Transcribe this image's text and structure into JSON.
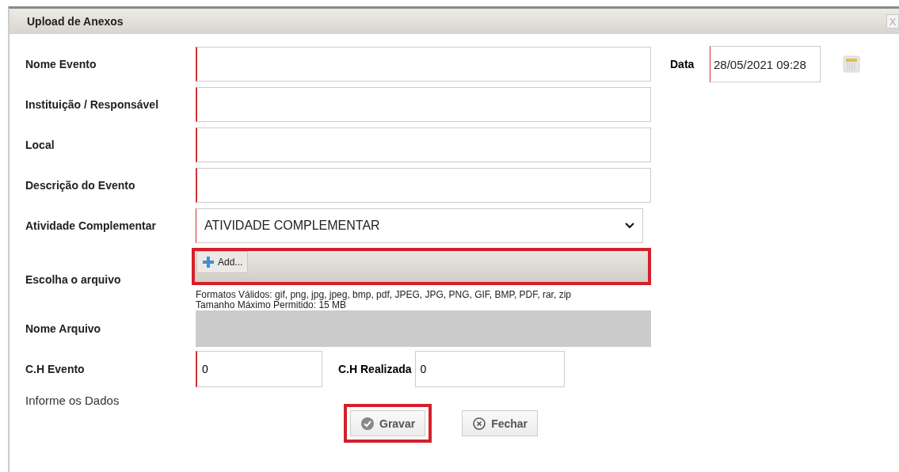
{
  "window": {
    "title": "Upload de Anexos",
    "close": "X"
  },
  "fields": [
    {
      "label": "Nome Evento",
      "required": true
    },
    {
      "label": "Instituição / Responsável",
      "required": true
    },
    {
      "label": "Local",
      "required": true
    },
    {
      "label": "Descrição do Evento",
      "required": true
    }
  ],
  "date": {
    "label": "Data",
    "value": "28/05/2021 09:28"
  },
  "activity": {
    "label": "Atividade Complementar",
    "value": "ATIVIDADE COMPLEMENTAR"
  },
  "file": {
    "label": "Escolha o arquivo",
    "add_button": "Add...",
    "highlighted": true,
    "formats": "Formatos Válidos: gif, png, jpg, jpeg, bmp, pdf, JPEG, JPG, PNG, GIF, BMP, PDF, rar, zip",
    "max_size": "Tamanho Máximo Permitido: 15 MB"
  },
  "file_name": {
    "label": "Nome Arquivo"
  },
  "hours": [
    {
      "label": "C.H Evento",
      "value": "0"
    },
    {
      "label": "C.H Realizada",
      "value": "0"
    }
  ],
  "message": "Informe os Dados",
  "buttons": [
    {
      "label": "Gravar",
      "kind": "save",
      "highlighted": true
    },
    {
      "label": "Fechar",
      "kind": "close",
      "highlighted": false
    }
  ]
}
